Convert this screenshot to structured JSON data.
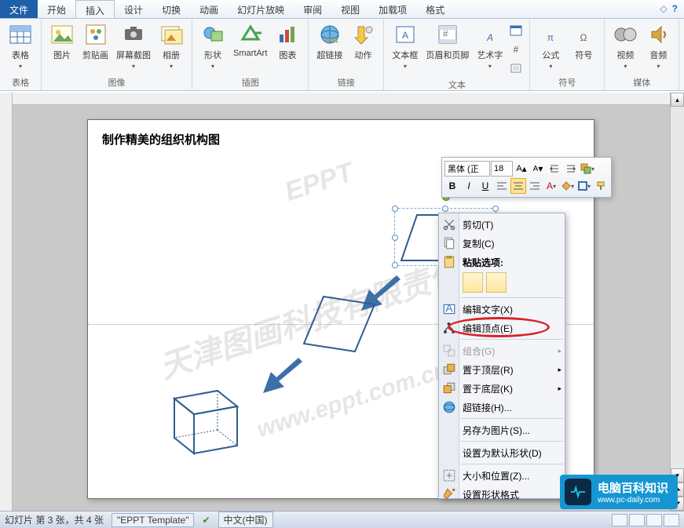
{
  "tabs": {
    "file": "文件",
    "items": [
      "开始",
      "插入",
      "设计",
      "切换",
      "动画",
      "幻灯片放映",
      "审阅",
      "视图",
      "加载项",
      "格式"
    ],
    "active": 1
  },
  "ribbon": {
    "groups": [
      {
        "label": "表格",
        "big": [
          {
            "name": "table",
            "label": "表格"
          }
        ]
      },
      {
        "label": "图像",
        "big": [
          {
            "name": "picture",
            "label": "图片"
          },
          {
            "name": "clipart",
            "label": "剪贴画"
          },
          {
            "name": "screenshot",
            "label": "屏幕截图"
          },
          {
            "name": "album",
            "label": "相册"
          }
        ]
      },
      {
        "label": "插图",
        "big": [
          {
            "name": "shapes",
            "label": "形状"
          },
          {
            "name": "smartart",
            "label": "SmartArt"
          },
          {
            "name": "chart",
            "label": "图表"
          }
        ]
      },
      {
        "label": "链接",
        "big": [
          {
            "name": "hyperlink",
            "label": "超链接"
          },
          {
            "name": "action",
            "label": "动作"
          }
        ]
      },
      {
        "label": "文本",
        "big": [
          {
            "name": "textbox",
            "label": "文本框"
          },
          {
            "name": "headerfooter",
            "label": "页眉和页脚"
          },
          {
            "name": "wordart",
            "label": "艺术字"
          }
        ]
      },
      {
        "label": "符号",
        "big": [
          {
            "name": "equation",
            "label": "公式"
          },
          {
            "name": "symbol",
            "label": "符号"
          }
        ]
      },
      {
        "label": "媒体",
        "big": [
          {
            "name": "video",
            "label": "视频"
          },
          {
            "name": "audio",
            "label": "音频"
          }
        ]
      }
    ]
  },
  "slide": {
    "title": "制作精美的组织机构图"
  },
  "mini": {
    "font": "黑体 (正",
    "size": "18",
    "buttons": {
      "bold": "B",
      "italic": "I",
      "underline": "U"
    }
  },
  "ctx": {
    "cut": "剪切(T)",
    "copy": "复制(C)",
    "paste_head": "粘贴选项:",
    "edit_text": "编辑文字(X)",
    "edit_points": "编辑顶点(E)",
    "group": "组合(G)",
    "bring_front": "置于顶层(R)",
    "send_back": "置于底层(K)",
    "hyperlink": "超链接(H)...",
    "save_pic": "另存为图片(S)...",
    "default_shape": "设置为默认形状(D)",
    "size_pos": "大小和位置(Z)...",
    "format_shape": "设置形状格式"
  },
  "status": {
    "slide_info": "幻灯片 第 3 张，共 4 张",
    "template": "\"EPPT Template\"",
    "lang": "中文(中国)"
  },
  "badge": {
    "title": "电脑百科知识",
    "url": "www.pc-daily.com"
  }
}
